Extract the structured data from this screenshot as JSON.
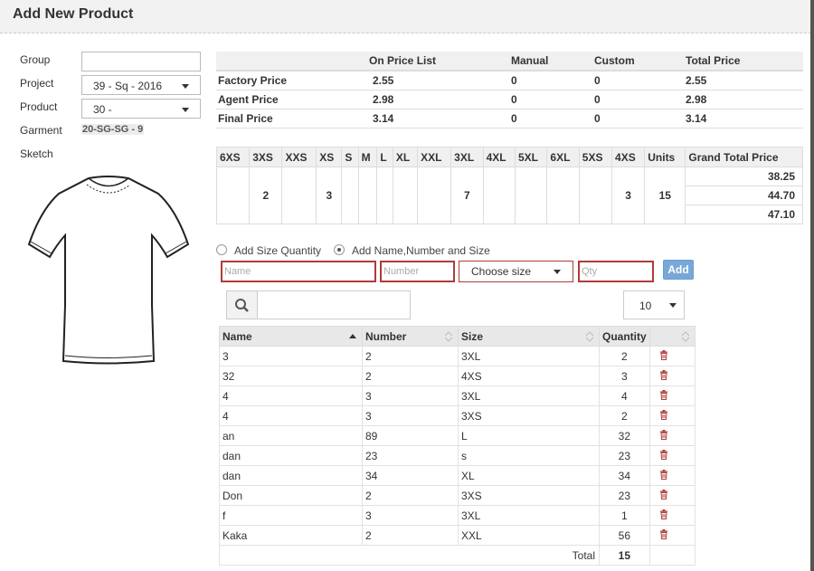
{
  "dialog": {
    "title": "Add New Product"
  },
  "form": {
    "group_label": "Group",
    "group_value": "",
    "project_label": "Project",
    "project_value": "39 - Sq - 2016",
    "product_label": "Product",
    "product_value": "30 -",
    "garment_label": "Garment",
    "garment_value": "20-SG-SG - 9",
    "sketch_label": "Sketch"
  },
  "price_table": {
    "headers": [
      "",
      "On Price List",
      "Manual",
      "Custom",
      "Total Price"
    ],
    "rows": [
      [
        "Factory Price",
        "2.55",
        "0",
        "0",
        "2.55"
      ],
      [
        "Agent Price",
        "2.98",
        "0",
        "0",
        "2.98"
      ],
      [
        "Final Price",
        "3.14",
        "0",
        "0",
        "3.14"
      ]
    ]
  },
  "sizes_table": {
    "headers": [
      "6XS",
      "3XS",
      "XXS",
      "XS",
      "S",
      "M",
      "L",
      "XL",
      "XXL",
      "3XL",
      "4XL",
      "5XL",
      "6XL",
      "5XS",
      "4XS",
      "Units",
      "Grand Total Price"
    ],
    "quantities": [
      "",
      "2",
      "",
      "3",
      "",
      "",
      "",
      "",
      "",
      "7",
      "",
      "",
      "",
      "",
      "3",
      "15"
    ],
    "grand_totals": [
      "38.25",
      "44.70",
      "47.10"
    ]
  },
  "mode": {
    "option1": "Add Size Quantity",
    "option2": "Add Name,Number and Size",
    "selected": "option2"
  },
  "entry": {
    "name_placeholder": "Name",
    "number_placeholder": "Number",
    "size_value": "Choose size",
    "qty_placeholder": "Qty",
    "add_label": "Add"
  },
  "search": {
    "value": "",
    "page_size": "10"
  },
  "names_table": {
    "headers": [
      "Name",
      "Number",
      "Size",
      "Quantity",
      ""
    ],
    "rows": [
      [
        "3",
        "2",
        "3XL",
        "2"
      ],
      [
        "32",
        "2",
        "4XS",
        "3"
      ],
      [
        "4",
        "3",
        "3XL",
        "4"
      ],
      [
        "4",
        "3",
        "3XS",
        "2"
      ],
      [
        "an",
        "89",
        "L",
        "32"
      ],
      [
        "dan",
        "23",
        "s",
        "23"
      ],
      [
        "dan",
        "34",
        "XL",
        "34"
      ],
      [
        "Don",
        "2",
        "3XS",
        "23"
      ],
      [
        "f",
        "3",
        "3XL",
        "1"
      ],
      [
        "Kaka",
        "2",
        "XXL",
        "56"
      ]
    ],
    "total_label": "Total",
    "total_value": "15"
  },
  "colors": {
    "accent": "#79a8d8",
    "error_border": "#b03a3a",
    "trash": "#b03a3a"
  },
  "icons": {
    "search": "search-icon",
    "trash": "trash-icon",
    "sort": "sort-icon",
    "caret": "caret-down-icon"
  }
}
